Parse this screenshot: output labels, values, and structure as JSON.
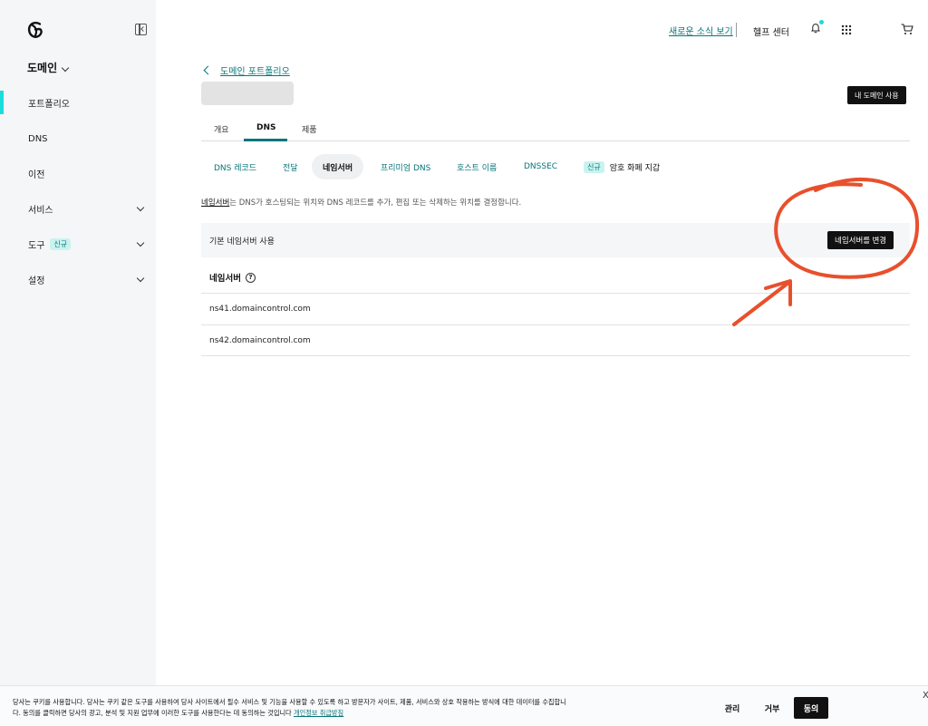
{
  "sidebar": {
    "header": "도메인",
    "items": [
      {
        "label": "포트폴리오"
      },
      {
        "label": "DNS"
      },
      {
        "label": "이전"
      },
      {
        "label": "서비스"
      },
      {
        "label": "도구",
        "badge": "신규"
      },
      {
        "label": "설정"
      }
    ]
  },
  "topbar": {
    "whats_new": "새로운 소식 보기",
    "help": "헬프 센터"
  },
  "main": {
    "back_link": "도메인 포트폴리오",
    "my_domain_button": "내 도메인 사용",
    "tabs": [
      "개요",
      "DNS",
      "제품"
    ],
    "subtabs": [
      {
        "label": "DNS 레코드"
      },
      {
        "label": "전달"
      },
      {
        "label": "네임서버"
      },
      {
        "label": "프리미엄 DNS"
      },
      {
        "label": "호스트 이름"
      },
      {
        "label": "DNSSEC"
      },
      {
        "badge": "신규",
        "label": "암호 화폐 지갑"
      }
    ],
    "description_link": "네임서버",
    "description_rest": "는 DNS가 호스팅되는 위치와 DNS 레코드를 추가, 편집 또는 삭제하는 위치를 결정합니다.",
    "default_ns_label": "기본 네임서버 사용",
    "change_ns_button": "네임서버를 변경",
    "ns_heading": "네임서버",
    "help_glyph": "?",
    "nameservers": [
      "ns41.domaincontrol.com",
      "ns42.domaincontrol.com"
    ]
  },
  "cookie": {
    "line1": "당사는 쿠키를 사용합니다. 당사는 쿠키 같은 도구를 사용하여 당사 사이트에서 필수 서비스 및 기능을 사용할 수 있도록 하고 방문자가 사이트, 제품, 서비스와 상호 작용하는 방식에 대한 데이터를 수집합니",
    "line2": "다. 동의를 클릭하면 당사의 광고, 분석 및 지원 업무에 이러한 도구를 사용한다는 데 동의하는 것입니다",
    "policy_link": "개인정보 취급방침",
    "manage": "관리",
    "reject": "거부",
    "agree": "동의",
    "close": "X"
  },
  "colors": {
    "accent": "#09757a",
    "active_indicator": "#1bdbdb",
    "annotation": "#e8502d",
    "button_dark": "#111111"
  }
}
